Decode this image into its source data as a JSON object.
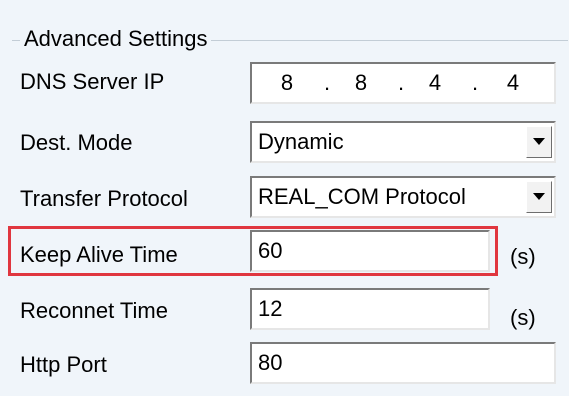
{
  "group": {
    "title": "Advanced Settings"
  },
  "rows": {
    "dns": {
      "label": "DNS Server IP",
      "octets": [
        "8",
        "8",
        "4",
        "4"
      ],
      "separator": "."
    },
    "dest_mode": {
      "label": "Dest. Mode",
      "value": "Dynamic"
    },
    "transfer_protocol": {
      "label": "Transfer Protocol",
      "value": "REAL_COM Protocol"
    },
    "keep_alive": {
      "label": "Keep Alive Time",
      "value": "60",
      "unit": "(s)"
    },
    "reconnect": {
      "label": "Reconnet Time",
      "value": "12",
      "unit": "(s)"
    },
    "http_port": {
      "label": "Http Port",
      "value": "80"
    }
  },
  "icons": {
    "dropdown": "chevron-down-icon"
  },
  "colors": {
    "background": "#f0f5fa",
    "highlight_border": "#e0363f",
    "field_background": "#ffffff"
  }
}
